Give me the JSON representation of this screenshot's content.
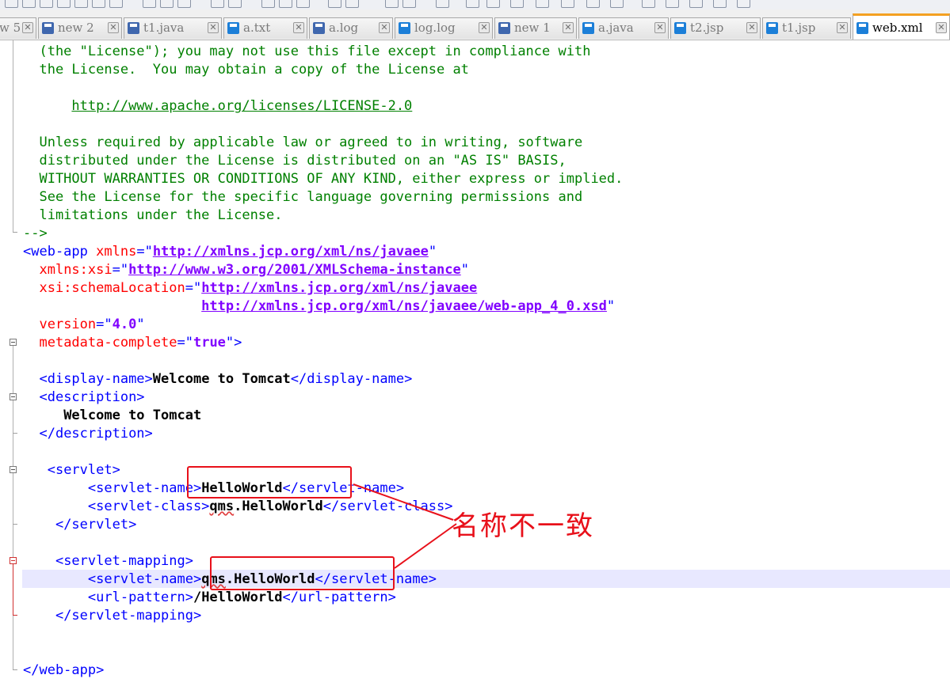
{
  "tabs": [
    {
      "label": "w 5"
    },
    {
      "label": "new 2"
    },
    {
      "label": "t1.java"
    },
    {
      "label": "a.txt"
    },
    {
      "label": "a.log"
    },
    {
      "label": "log.log"
    },
    {
      "label": "new 1"
    },
    {
      "label": "a.java"
    },
    {
      "label": "t2.jsp"
    },
    {
      "label": "t1.jsp"
    },
    {
      "label": "web.xml",
      "active": true
    }
  ],
  "editor": {
    "lines": {
      "l1": "  (the \"License\"); you may not use this file except in compliance with",
      "l2": "  the License.  You may obtain a copy of the License at",
      "l4_url": "http://www.apache.org/licenses/LICENSE-2.0",
      "l6": "  Unless required by applicable law or agreed to in writing, software",
      "l7": "  distributed under the License is distributed on an \"AS IS\" BASIS,",
      "l8": "  WITHOUT WARRANTIES OR CONDITIONS OF ANY KIND, either express or implied.",
      "l9": "  See the License for the specific language governing permissions and",
      "l10": "  limitations under the License.",
      "l11": "-->",
      "web_app_open": "<web-app",
      "xmlns_attr": "xmlns",
      "xmlns_val": "http://xmlns.jcp.org/xml/ns/javaee",
      "xsi_attr": "xmlns:xsi",
      "xsi_val": "http://www.w3.org/2001/XMLSchema-instance",
      "schema_attr": "xsi:schemaLocation",
      "schema_val1": "http://xmlns.jcp.org/xml/ns/javaee",
      "schema_val2": "http://xmlns.jcp.org/xml/ns/javaee/web-app_4_0.xsd",
      "version_attr": "version",
      "version_val": "4.0",
      "metadata_attr": "metadata-complete",
      "metadata_val": "true",
      "display_open": "<display-name>",
      "display_text": "Welcome to Tomcat",
      "display_close": "</display-name>",
      "desc_open": "<description>",
      "desc_text": "Welcome to Tomcat",
      "desc_close": "</description>",
      "servlet_open": "<servlet>",
      "sname_open": "<servlet-name>",
      "sname_text": "HelloWorld",
      "sname_close": "</servlet-name>",
      "sclass_open": "<servlet-class>",
      "sclass_text_pkg": "qms",
      "sclass_text_rest": ".HelloWorld",
      "sclass_close": "</servlet-class>",
      "servlet_close": "</servlet>",
      "mapping_open": "<servlet-mapping>",
      "mname_open": "<servlet-name>",
      "mname_text_pkg": "qms",
      "mname_text_rest": ".HelloWorld",
      "mname_close": "</servlet-name>",
      "url_open": "<url-pattern>",
      "url_text": "/HelloWorld",
      "url_close": "</url-pattern>",
      "mapping_close": "</servlet-mapping>",
      "web_app_close": "</web-app>"
    }
  },
  "annotation": {
    "text": "名称不一致"
  },
  "colors": {
    "comment": "#008000",
    "tag": "#0000ff",
    "attribute": "#ff0000",
    "value": "#8000ff",
    "annotation": "#e8101a",
    "active_tab_accent": "#f4a020"
  }
}
